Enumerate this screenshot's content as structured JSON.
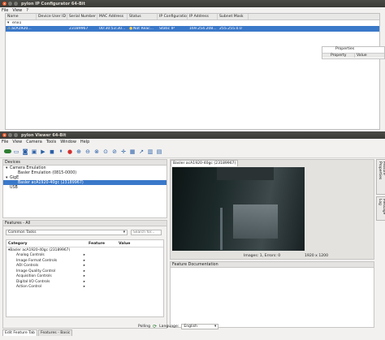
{
  "ipconfig": {
    "title": "pylon IP Configurator 64-Bit",
    "menu": [
      "File",
      "View",
      "?"
    ],
    "columns": [
      "Name",
      "Device User ID",
      "Serial Number",
      "MAC Address",
      "Status",
      "IP Configuration",
      "IP Address",
      "Subnet Mask"
    ],
    "group_row": "enx1",
    "camera_row": {
      "name": "acA1920...",
      "user_id": "",
      "serial": "23189967",
      "mac": "00:30:53:30...",
      "status": "Not Reac...",
      "ip_config": "Static IP",
      "ip": "169.254.208...",
      "subnet": "255.255.0.0"
    },
    "side_panel_title": "Properties",
    "side_panel_column": "Property",
    "side_panel_value": "Value"
  },
  "viewer": {
    "title": "pylon Viewer 64-Bit",
    "menu": [
      "File",
      "View",
      "Camera",
      "Tools",
      "Window",
      "Help"
    ],
    "devices_panel_title": "Devices",
    "devices_tree": [
      {
        "label": "Camera Emulation",
        "level": 0,
        "expander": "▾"
      },
      {
        "label": "Basler Emulation (0815-0000)",
        "level": 1,
        "expander": ""
      },
      {
        "label": "GigE",
        "level": 0,
        "expander": "▾"
      },
      {
        "label": "Basler acA1920-40gc (23189967)",
        "level": 1,
        "expander": "",
        "selected": true
      },
      {
        "label": "USB",
        "level": 0,
        "expander": ""
      }
    ],
    "features_panel_title": "Features - All",
    "features_filter": "Common Tasks",
    "features_search_placeholder": "Search for...",
    "features_columns": [
      "Category",
      "Feature",
      "Value"
    ],
    "features_root": "Basler acA1920-40gc (23189967)",
    "features_categories": [
      "Analog Controls",
      "Image Format Controls",
      "AOI Controls",
      "Image Quality Control",
      "Acquisition Controls",
      "Digital I/O Controls",
      "Action Control"
    ],
    "bottom_tabs": [
      "Edit Feature Tab",
      "Features - Basic"
    ],
    "image_tab": "Basler acA1920-40gc (23189967)",
    "status": {
      "images": "Images: 1, Errors: 0",
      "resolution": "1920 x 1200"
    },
    "feature_doc_title": "Feature Documentation",
    "right_tabs": [
      "Feature Properties",
      "Message Log"
    ],
    "footer": {
      "polling_label": "Polling",
      "language_label": "Language:",
      "language_value": "English"
    }
  }
}
